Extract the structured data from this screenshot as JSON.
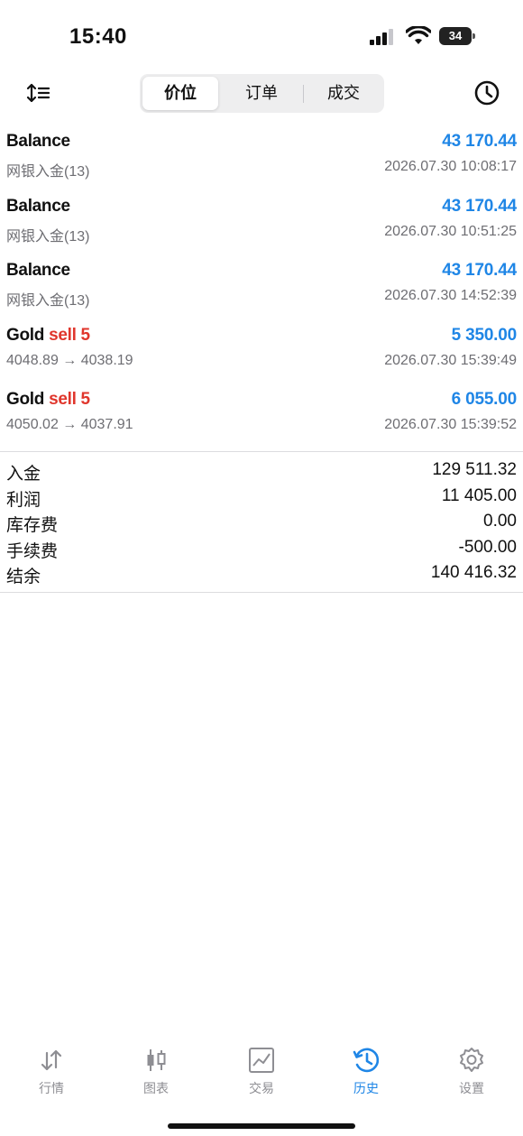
{
  "status": {
    "time": "15:40",
    "battery": "34"
  },
  "toolbar": {
    "tabs": [
      "价位",
      "订单",
      "成交"
    ],
    "active_tab": 0
  },
  "deals": [
    {
      "symbol": "Balance",
      "action": "",
      "amount": "43 170.44",
      "detail": "网银入金(13)",
      "time": "2026.07.30 10:08:17"
    },
    {
      "symbol": "Balance",
      "action": "",
      "amount": "43 170.44",
      "detail": "网银入金(13)",
      "time": "2026.07.30 10:51:25"
    },
    {
      "symbol": "Balance",
      "action": "",
      "amount": "43 170.44",
      "detail": "网银入金(13)",
      "time": "2026.07.30 14:52:39"
    },
    {
      "symbol": "Gold",
      "action": "sell 5",
      "amount": "5 350.00",
      "detail": "4048.89 → 4038.19",
      "time": "2026.07.30 15:39:49"
    },
    {
      "symbol": "Gold",
      "action": "sell 5",
      "amount": "6 055.00",
      "detail": "4050.02 → 4037.91",
      "time": "2026.07.30 15:39:52"
    }
  ],
  "summary": [
    {
      "label": "入金",
      "value": "129 511.32"
    },
    {
      "label": "利润",
      "value": "11 405.00"
    },
    {
      "label": "库存费",
      "value": "0.00"
    },
    {
      "label": "手续费",
      "value": "-500.00"
    },
    {
      "label": "结余",
      "value": "140 416.32"
    }
  ],
  "tabbar": {
    "items": [
      {
        "label": "行情",
        "icon": "quotes-arrows-icon"
      },
      {
        "label": "图表",
        "icon": "candlestick-chart-icon"
      },
      {
        "label": "交易",
        "icon": "trade-chart-icon"
      },
      {
        "label": "历史",
        "icon": "history-clock-icon"
      },
      {
        "label": "设置",
        "icon": "settings-gear-icon"
      }
    ],
    "active_index": 3
  },
  "colors": {
    "accent": "#1f86e6",
    "sell": "#e0362c",
    "muted": "#6e6e73"
  }
}
